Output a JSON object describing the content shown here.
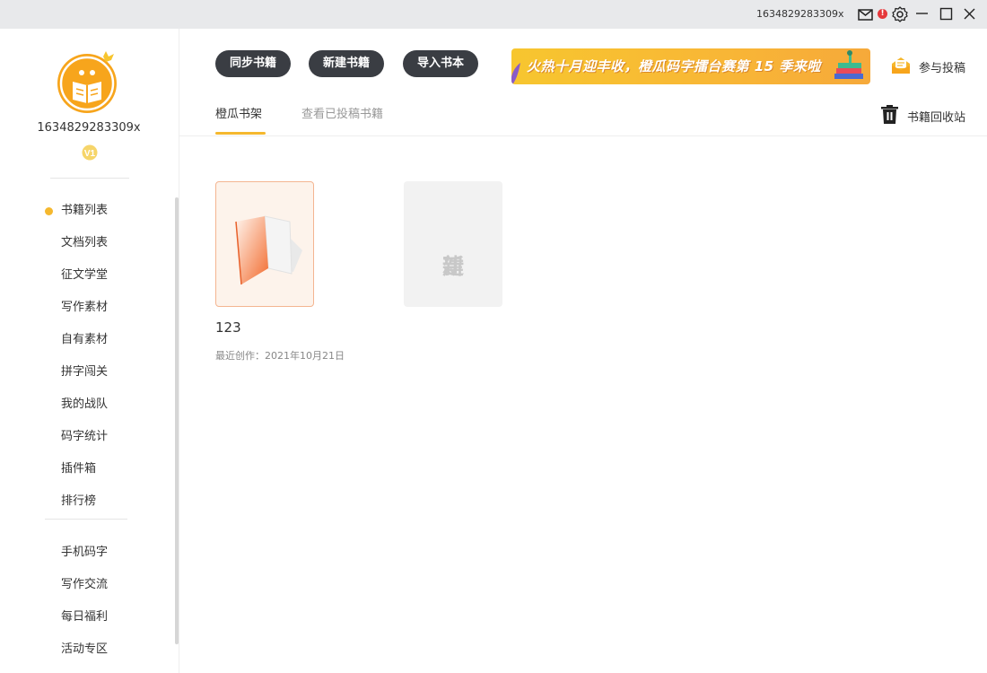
{
  "titlebar": {
    "username": "1634829283309x",
    "mail_badge": "!",
    "icons": [
      "mail-icon",
      "gear-icon",
      "minimize-icon",
      "maximize-icon",
      "close-icon"
    ]
  },
  "sidebar": {
    "username": "1634829283309x",
    "vip_badge": "V1",
    "nav_primary": [
      {
        "label": "书籍列表",
        "active": true
      },
      {
        "label": "文档列表"
      },
      {
        "label": "征文学堂"
      },
      {
        "label": "写作素材"
      },
      {
        "label": "自有素材"
      },
      {
        "label": "拼字闯关"
      },
      {
        "label": "我的战队"
      },
      {
        "label": "码字统计"
      },
      {
        "label": "插件箱"
      },
      {
        "label": "排行榜"
      }
    ],
    "nav_secondary": [
      {
        "label": "手机码字"
      },
      {
        "label": "写作交流"
      },
      {
        "label": "每日福利"
      },
      {
        "label": "活动专区"
      }
    ]
  },
  "toolbar": {
    "sync_label": "同步书籍",
    "new_label": "新建书籍",
    "import_label": "导入书本",
    "banner_text": "火热十月迎丰收，橙瓜码字擂台赛第 15 季来啦",
    "submit_label": "参与投稿"
  },
  "tabs": {
    "shelf": "橙瓜书架",
    "submitted": "查看已投稿书籍",
    "active": "shelf"
  },
  "recycle_label": "书籍回收站",
  "books": [
    {
      "title": "123",
      "meta": "最近创作：2021年10月21日"
    }
  ],
  "new_card": {
    "line1": "新",
    "line2": "建"
  },
  "colors": {
    "accent": "#f5b82e",
    "button_dark": "#3a3d43",
    "book_border": "#f4b591"
  }
}
